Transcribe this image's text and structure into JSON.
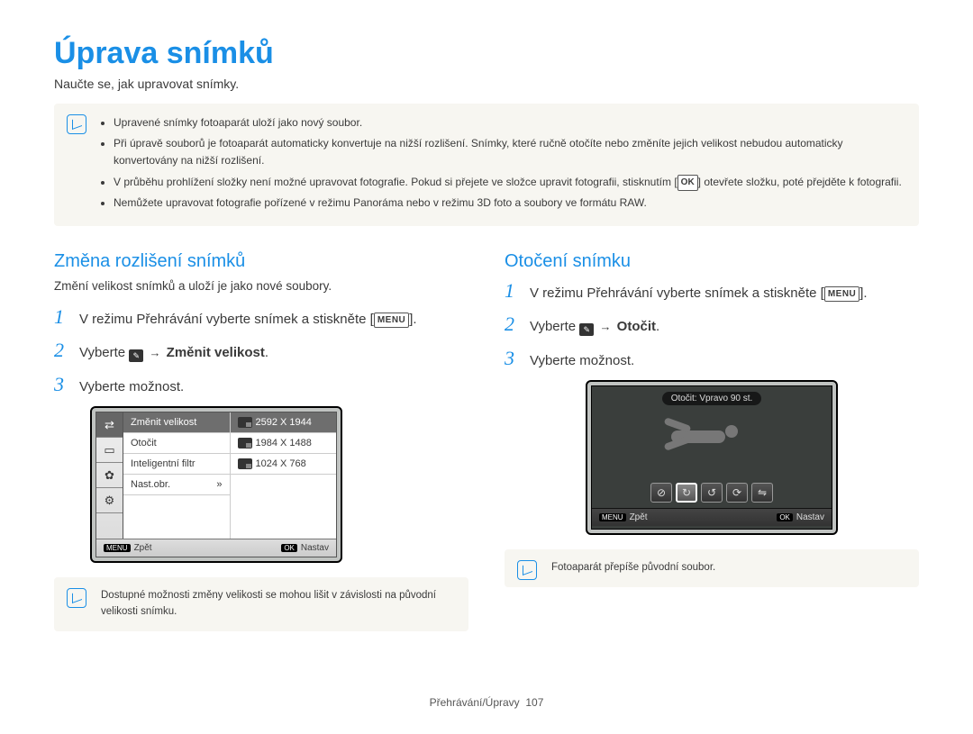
{
  "title": "Úprava snímků",
  "intro": "Naučte se, jak upravovat snímky.",
  "topnote": {
    "items": [
      "Upravené snímky fotoaparát uloží jako nový soubor.",
      {
        "pre": "Při úpravě souborů je fotoaparát automaticky konvertuje na nižší rozlišení. Snímky, které ručně otočíte nebo změníte jejich velikost nebudou automaticky konvertovány na nižší rozlišení."
      },
      {
        "pre": "V průběhu prohlížení složky není možné upravovat fotografie. Pokud si přejete ve složce upravit fotografii, stisknutím [",
        "badge": "OK",
        "post": "] otevřete složku, poté přejděte k fotografii."
      },
      "Nemůžete upravovat fotografie pořízené v režimu Panoráma nebo v režimu 3D foto a soubory ve formátu RAW."
    ]
  },
  "left": {
    "heading": "Změna rozlišení snímků",
    "lead": "Změní velikost snímků a uloží je jako nové soubory.",
    "step1": {
      "pre": "V režimu Přehrávání vyberte snímek a stiskněte [",
      "badge": "MENU",
      "post": "]."
    },
    "step2": {
      "pre": "Vyberte ",
      "arrow": "→",
      "bold": "Změnit velikost",
      "post": "."
    },
    "step3": "Vyberte možnost.",
    "lcd": {
      "menu": [
        "Změnit velikost",
        "Otočit",
        "Inteligentní filtr",
        "Nast.obr."
      ],
      "sizes": [
        "2592 X 1944",
        "1984 X 1488",
        "1024 X 768"
      ],
      "nast_suffix": "»",
      "back": "Zpět",
      "back_btn": "MENU",
      "set": "Nastav",
      "set_btn": "OK"
    },
    "note": "Dostupné možnosti změny velikosti se mohou lišit v závislosti na původní velikosti snímku."
  },
  "right": {
    "heading": "Otočení snímku",
    "step1": {
      "pre": "V režimu Přehrávání vyberte snímek a stiskněte [",
      "badge": "MENU",
      "post": "]."
    },
    "step2": {
      "pre": "Vyberte ",
      "arrow": "→",
      "bold": "Otočit",
      "post": "."
    },
    "step3": "Vyberte možnost.",
    "lcd": {
      "caption": "Otočit: Vpravo 90 st.",
      "back": "Zpět",
      "back_btn": "MENU",
      "set": "Nastav",
      "set_btn": "OK"
    },
    "note": "Fotoaparát přepíše původní soubor."
  },
  "footer": {
    "section": "Přehrávání/Úpravy",
    "page": "107"
  }
}
